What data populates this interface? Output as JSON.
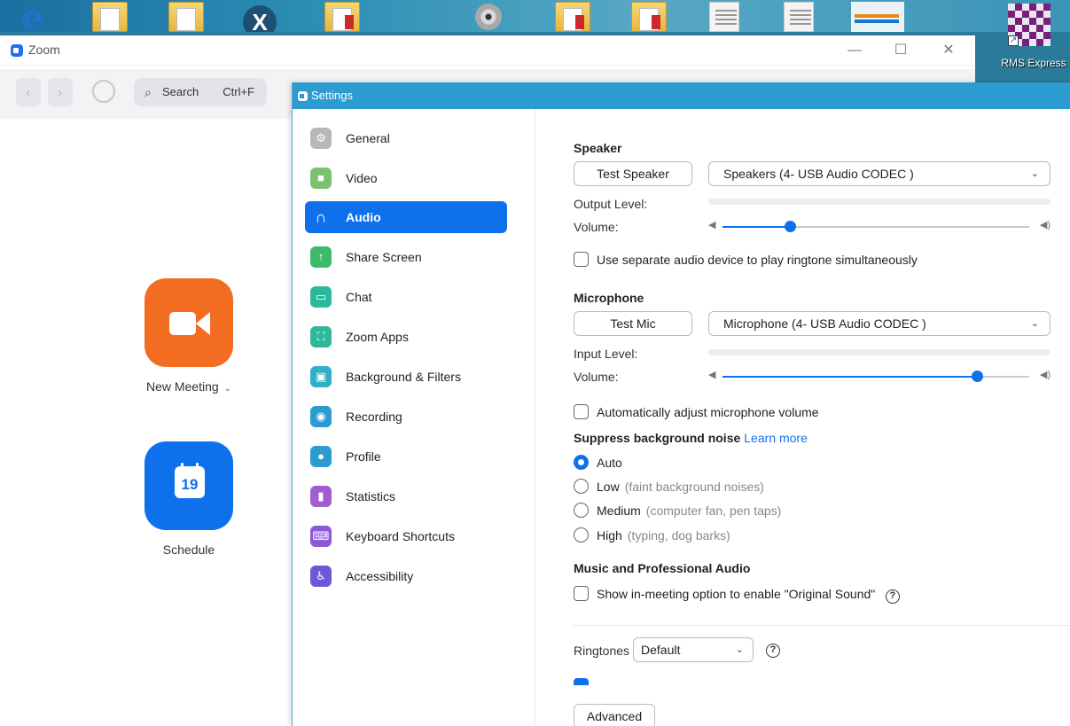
{
  "desktop": {
    "shortcut_label": "RMS Express"
  },
  "zoom": {
    "title": "Zoom",
    "window_controls": {
      "minimize": "—",
      "maximize": "☐",
      "close": "✕"
    },
    "search": {
      "label": "Search",
      "shortcut": "Ctrl+F"
    },
    "home": {
      "new_meeting_label": "New Meeting",
      "schedule_label": "Schedule",
      "calendar_day": "19"
    }
  },
  "settings": {
    "title": "Settings",
    "sidebar": [
      {
        "label": "General",
        "icon": "gear-icon",
        "color": "#b8b8bc"
      },
      {
        "label": "Video",
        "icon": "video-icon",
        "color": "#7cc26e"
      },
      {
        "label": "Audio",
        "icon": "headphones-icon",
        "color": "#0e71eb",
        "active": true
      },
      {
        "label": "Share Screen",
        "icon": "share-screen-icon",
        "color": "#3dbb6a"
      },
      {
        "label": "Chat",
        "icon": "chat-icon",
        "color": "#2cb89a"
      },
      {
        "label": "Zoom Apps",
        "icon": "apps-icon",
        "color": "#2cb89a"
      },
      {
        "label": "Background & Filters",
        "icon": "background-icon",
        "color": "#2eb0c8"
      },
      {
        "label": "Recording",
        "icon": "recording-icon",
        "color": "#2b9bd0"
      },
      {
        "label": "Profile",
        "icon": "profile-icon",
        "color": "#2b9bd0"
      },
      {
        "label": "Statistics",
        "icon": "statistics-icon",
        "color": "#a25ed1"
      },
      {
        "label": "Keyboard Shortcuts",
        "icon": "keyboard-icon",
        "color": "#8c5ad6"
      },
      {
        "label": "Accessibility",
        "icon": "accessibility-icon",
        "color": "#6a5ad6"
      }
    ],
    "audio": {
      "speaker": {
        "title": "Speaker",
        "test_button": "Test Speaker",
        "device": "Speakers (4- USB Audio CODEC )",
        "output_level_label": "Output Level:",
        "volume_label": "Volume:",
        "volume": 0.22
      },
      "separate_device": {
        "label": "Use separate audio device to play ringtone simultaneously",
        "checked": false
      },
      "microphone": {
        "title": "Microphone",
        "test_button": "Test Mic",
        "device": "Microphone (4- USB Audio CODEC )",
        "input_level_label": "Input Level:",
        "volume_label": "Volume:",
        "volume": 0.83
      },
      "auto_adjust": {
        "label": "Automatically adjust microphone volume",
        "checked": false
      },
      "suppress": {
        "title": "Suppress background noise",
        "learn_more": "Learn more",
        "options": [
          {
            "label": "Auto",
            "hint": "",
            "selected": true
          },
          {
            "label": "Low",
            "hint": "(faint background noises)",
            "selected": false
          },
          {
            "label": "Medium",
            "hint": "(computer fan, pen taps)",
            "selected": false
          },
          {
            "label": "High",
            "hint": "(typing, dog barks)",
            "selected": false
          }
        ]
      },
      "music": {
        "title": "Music and Professional Audio",
        "original_sound_label": "Show in-meeting option to enable \"Original Sound\"",
        "checked": false
      },
      "ringtones": {
        "label": "Ringtones",
        "value": "Default"
      },
      "advanced_button": "Advanced"
    }
  }
}
